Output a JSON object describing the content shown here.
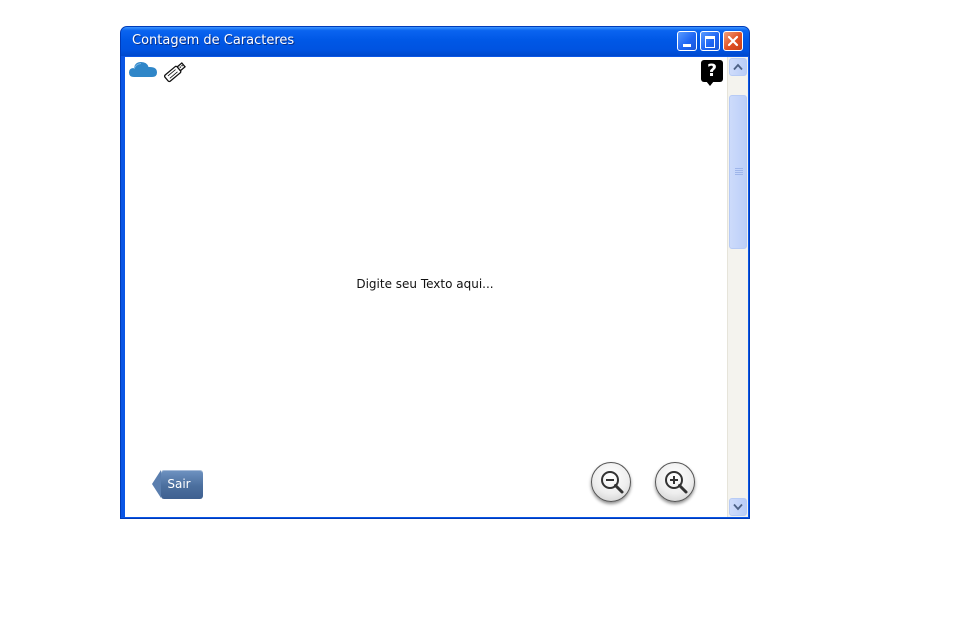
{
  "window": {
    "title": "Contagem de Caracteres",
    "accent_color": "#0a56e6",
    "close_color": "#e04f23"
  },
  "toolbar": {
    "icons": [
      "cloud-icon",
      "usb-drive-icon",
      "help-icon"
    ],
    "help_label": "?"
  },
  "editor": {
    "placeholder": "Digite seu Texto aqui...",
    "value": ""
  },
  "footer": {
    "exit_label": "Sair",
    "exit_color": "#4b6f9e",
    "zoom_icons": [
      "zoom-out-icon",
      "zoom-in-icon"
    ]
  },
  "scrollbar": {
    "thumb_color": "#bccff8"
  }
}
